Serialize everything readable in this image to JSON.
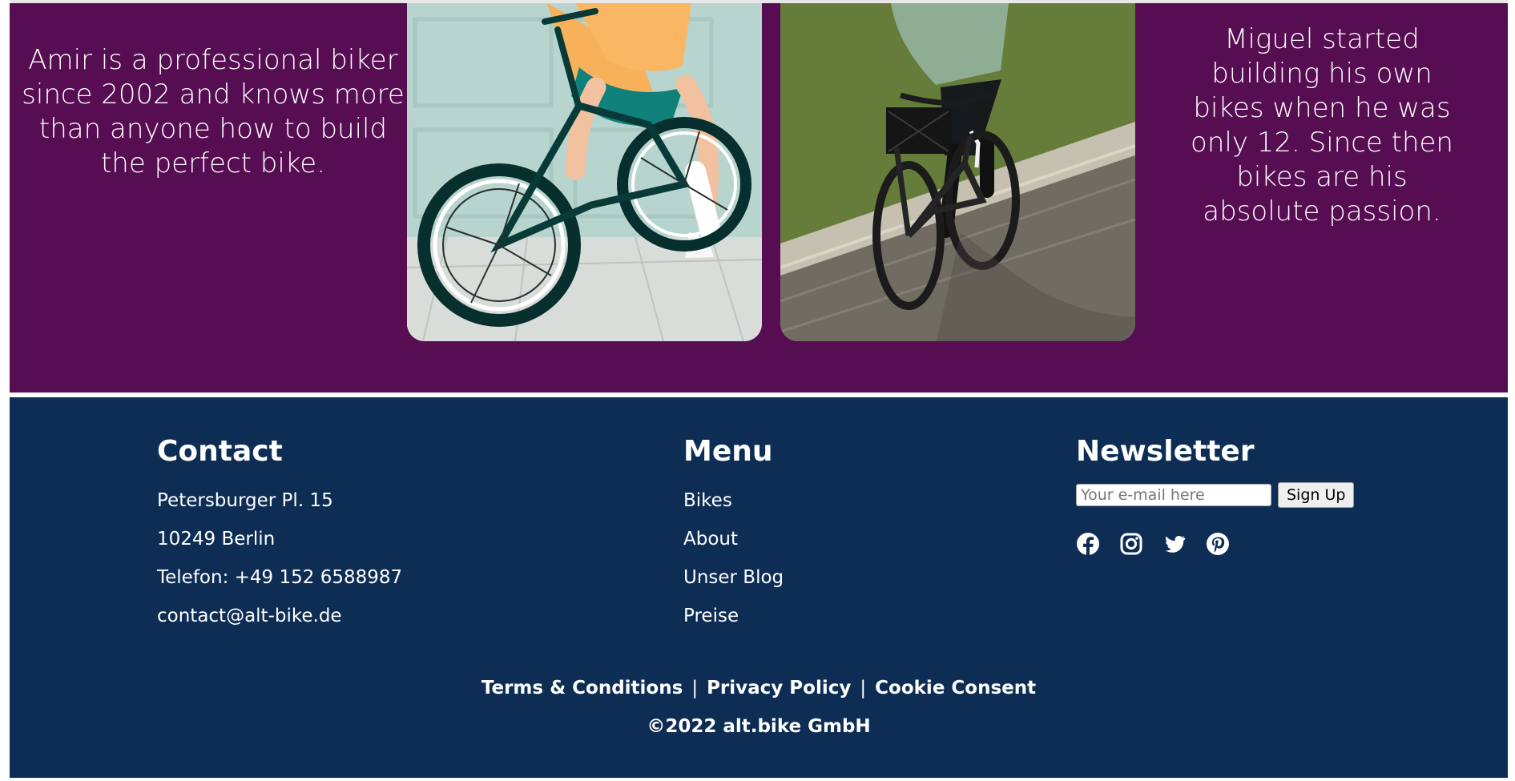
{
  "team": {
    "person_left_name": "Amir",
    "person_left_bio": "Amir is a professional biker since 2002 and knows more than anyone how to build the perfect bike.",
    "person_right_bio": "Miguel started building his own bikes when he was only 12. Since then bikes are his absolute passion.",
    "photo_left_icon": "bmx-bike-photo",
    "photo_right_icon": "road-cycling-photo"
  },
  "footer": {
    "contact": {
      "heading": "Contact",
      "lines": [
        "Petersburger Pl. 15",
        "10249 Berlin",
        "Telefon: +49 152 6588987",
        "contact@alt-bike.de"
      ]
    },
    "menu": {
      "heading": "Menu",
      "items": [
        "Bikes",
        "About",
        "Unser Blog",
        "Preise"
      ]
    },
    "newsletter": {
      "heading": "Newsletter",
      "email_placeholder": "Your e-mail here",
      "email_value": "",
      "button_label": "Sign Up",
      "social_icons": [
        "facebook-icon",
        "instagram-icon",
        "twitter-icon",
        "pinterest-icon"
      ]
    },
    "legal": {
      "terms": "Terms & Conditions",
      "separator": "|",
      "privacy": "Privacy Policy",
      "cookie": "Cookie Consent"
    },
    "copyright": "©2022 alt.bike GmbH"
  },
  "colors": {
    "team_background": "#560d52",
    "footer_background": "#0d2d55",
    "text": "#ffffff"
  }
}
